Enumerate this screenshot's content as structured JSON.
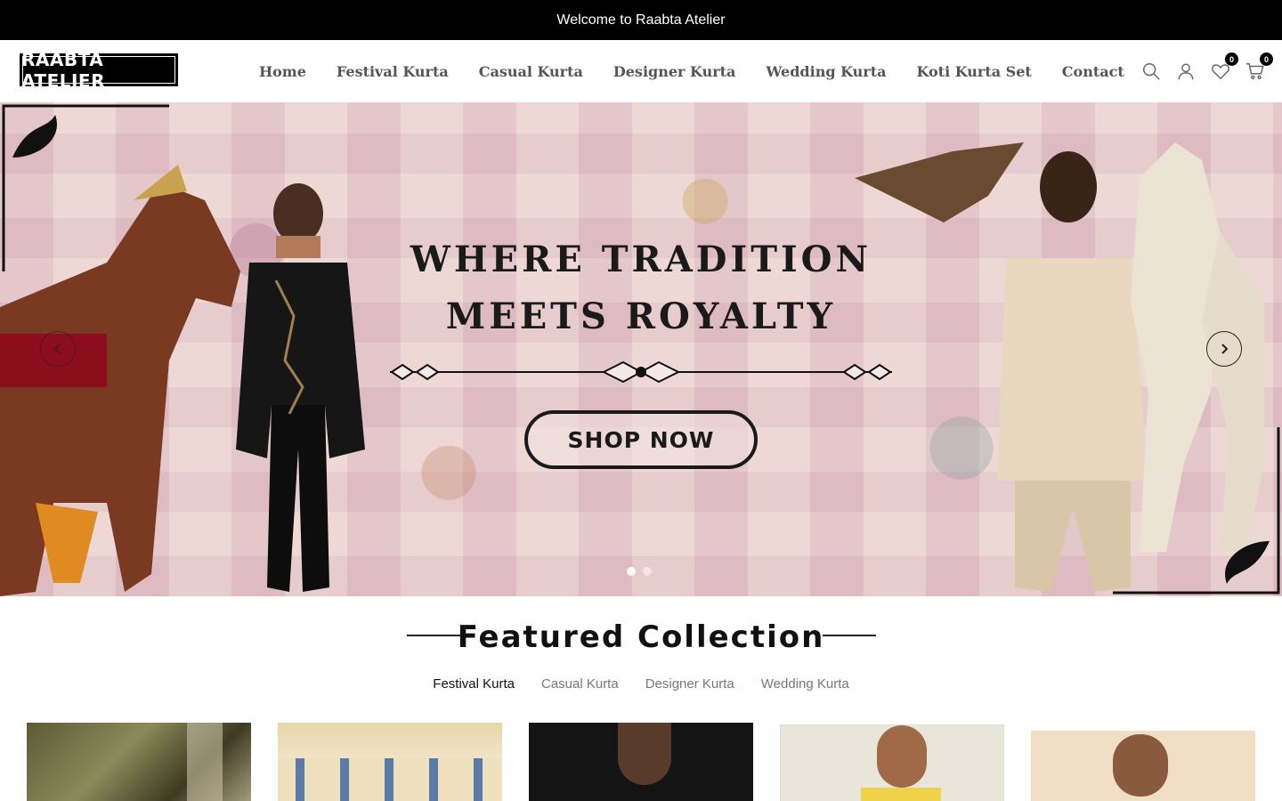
{
  "announcement": "Welcome to Raabta Atelier",
  "brand": {
    "logo_text": "RAABTA ATELIER"
  },
  "nav": {
    "items": [
      {
        "label": "Home"
      },
      {
        "label": "Festival Kurta"
      },
      {
        "label": "Casual Kurta"
      },
      {
        "label": "Designer Kurta"
      },
      {
        "label": "Wedding Kurta"
      },
      {
        "label": "Koti Kurta Set"
      },
      {
        "label": "Contact"
      }
    ]
  },
  "header_icons": {
    "search": "search-icon",
    "account": "user-icon",
    "wishlist": {
      "icon": "heart-icon",
      "count": "0"
    },
    "cart": {
      "icon": "cart-icon",
      "count": "0"
    }
  },
  "hero": {
    "title_line1": "WHERE TRADITION",
    "title_line2": "MEETS ROYALTY",
    "cta": "SHOP NOW",
    "slide_count": 2,
    "active_slide": 1
  },
  "featured": {
    "title": "Featured Collection",
    "tabs": [
      {
        "label": "Festival Kurta",
        "active": true
      },
      {
        "label": "Casual Kurta",
        "active": false
      },
      {
        "label": "Designer Kurta",
        "active": false
      },
      {
        "label": "Wedding Kurta",
        "active": false
      }
    ],
    "products": [
      {
        "image": "olive embroidered kurta"
      },
      {
        "image": "palace courtyard kurta"
      },
      {
        "image": "dark studio portrait"
      },
      {
        "image": "yellow kurta portrait"
      },
      {
        "image": "smiling man portrait"
      }
    ]
  },
  "colors": {
    "announcement_bg": "#000000",
    "accent": "#000000",
    "nav_text": "#555555"
  }
}
